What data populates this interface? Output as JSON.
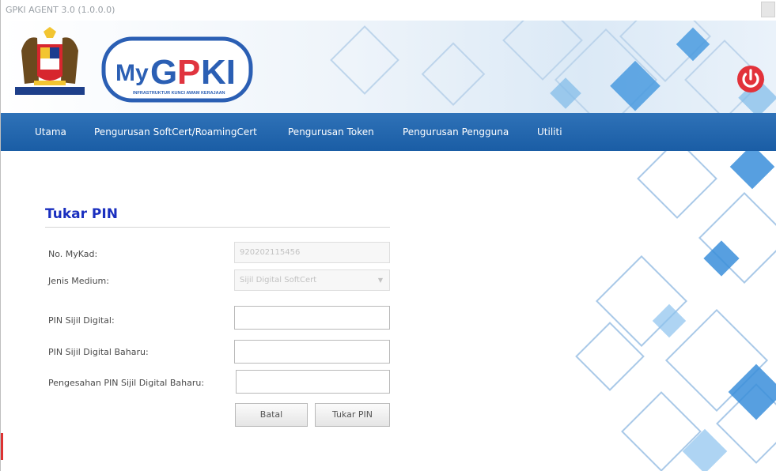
{
  "window": {
    "title": "GPKI AGENT 3.0 (1.0.0.0)"
  },
  "header": {
    "logo_text": "MyGPKI",
    "logo_subtext": "INFRASTRUKTUR KUNCI AWAM KERAJAAN",
    "power_icon": "power-icon",
    "colors": {
      "logo_blue": "#2b5fb4",
      "logo_red": "#e0343f",
      "power": "#e2323a"
    }
  },
  "nav": {
    "items": [
      {
        "label": "Utama"
      },
      {
        "label": "Pengurusan SoftCert/RoamingCert"
      },
      {
        "label": "Pengurusan Token"
      },
      {
        "label": "Pengurusan Pengguna"
      },
      {
        "label": "Utiliti"
      }
    ],
    "colors": {
      "bg": "#1f63aa",
      "text": "#ffffff"
    }
  },
  "form": {
    "title": "Tukar PIN",
    "mykad": {
      "label": "No. MyKad:",
      "value": "920202115456"
    },
    "medium": {
      "label": "Jenis Medium:",
      "value": "Sijil Digital SoftCert"
    },
    "pin": {
      "label": "PIN Sijil Digital:",
      "value": ""
    },
    "new_pin": {
      "label": "PIN Sijil Digital Baharu:",
      "value": ""
    },
    "confirm_pin": {
      "label": "Pengesahan PIN Sijil Digital Baharu:",
      "value": ""
    },
    "buttons": {
      "cancel": "Batal",
      "submit": "Tukar PIN"
    },
    "colors": {
      "title": "#1a2fbf"
    }
  }
}
